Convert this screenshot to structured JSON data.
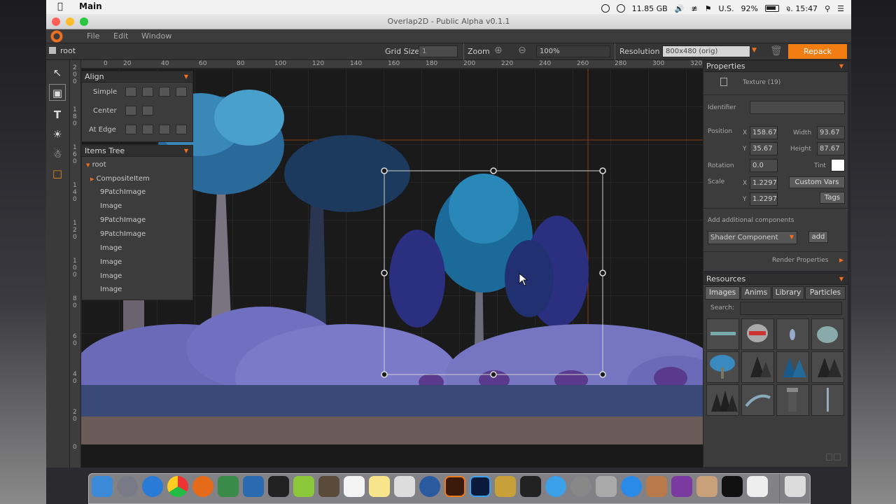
{
  "menubar": {
    "apple": "",
    "app_name": "Main",
    "storage": "11.85 GB",
    "keyboard": "U.S.",
    "battery": "92%",
    "clock": "จ. 15:47"
  },
  "window": {
    "title": "Overlap2D - Public Alpha v0.1.1"
  },
  "app_menu": [
    "File",
    "Edit",
    "Window"
  ],
  "toolbar": {
    "breadcrumb": "root",
    "grid_size_label": "Grid Size",
    "grid_size_value": "1",
    "zoom_label": "Zoom",
    "zoom_value": "100%",
    "resolution_label": "Resolution",
    "resolution_value": "800x480 (orig)",
    "repack_label": "Repack"
  },
  "rulers": {
    "top": [
      "0",
      "20",
      "40",
      "60",
      "80",
      "100",
      "120",
      "140",
      "160",
      "180",
      "200",
      "220",
      "240",
      "260",
      "280",
      "300",
      "320"
    ],
    "left": [
      "2\n0\n0",
      "1\n8\n0",
      "1\n6\n0",
      "1\n4\n0",
      "1\n2\n0",
      "1\n0\n0",
      "8\n0",
      "6\n0",
      "4\n0",
      "2\n0",
      "0"
    ]
  },
  "align_panel": {
    "title": "Align",
    "rows": [
      {
        "label": "Simple"
      },
      {
        "label": "Center"
      },
      {
        "label": "At Edge"
      }
    ]
  },
  "items_tree": {
    "title": "Items Tree",
    "items": [
      "root",
      "CompositeItem",
      "9PatchImage",
      "Image",
      "9PatchImage",
      "9PatchImage",
      "Image",
      "Image",
      "Image",
      "Image"
    ]
  },
  "properties": {
    "title": "Properties",
    "texture": "Texture (19)",
    "identifier_label": "Identifier",
    "identifier_value": "",
    "position_label": "Position",
    "x_label": "X",
    "y_label": "Y",
    "pos_x": "158.67",
    "pos_y": "35.67",
    "width_label": "Width",
    "width": "93.67",
    "height_label": "Height",
    "height": "87.67",
    "rotation_label": "Rotation",
    "rotation": "0.0",
    "tint_label": "Tint",
    "scale_label": "Scale",
    "scale_x": "1.2297",
    "scale_y": "1.2297",
    "custom_vars": "Custom Vars",
    "tags": "Tags",
    "add_components_label": "Add additional components",
    "component_select": "Shader Component",
    "add_button": "add",
    "render_properties": "Render Properties"
  },
  "resources": {
    "title": "Resources",
    "tabs": [
      "Images",
      "Anims",
      "Library",
      "Particles"
    ],
    "search_label": "Search:",
    "search_value": ""
  },
  "colors": {
    "accent": "#f27d13",
    "canvas": "#1a1a1a",
    "panel": "#3c3c3c"
  },
  "dock_icons": [
    "finder-icon",
    "launchpad-icon",
    "safari-icon",
    "chrome-icon",
    "firefox-icon",
    "android-studio-icon",
    "xcode-icon",
    "unity-icon",
    "android-icon",
    "sublime-icon",
    "calendar-icon",
    "notes-icon",
    "text-icon",
    "quicktime-icon",
    "illustrator-icon",
    "photoshop-icon",
    "game-icon",
    "inkscape-icon",
    "appstore-icon",
    "preferences-icon",
    "vm-icon",
    "teamviewer-icon",
    "library-icon",
    "monitor-icon",
    "archive-icon",
    "terminal-icon",
    "java-icon",
    "trash-icon"
  ]
}
